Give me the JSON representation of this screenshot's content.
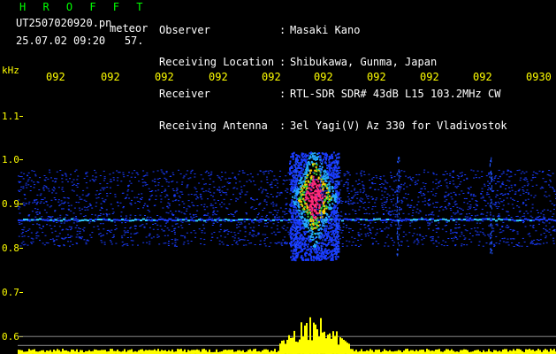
{
  "header": {
    "title": "H R O F F T",
    "file": "UT2507020920.pn",
    "kind": "meteor",
    "stamp": "25.07.02 09:20   57."
  },
  "meta": [
    {
      "label": "Observer",
      "value": "Masaki Kano"
    },
    {
      "label": "Receiving Location",
      "value": "Shibukawa, Gunma, Japan"
    },
    {
      "label": "Receiver",
      "value": "RTL-SDR SDR# 43dB L15 103.2MHz CW"
    },
    {
      "label": "Receiving Antenna",
      "value": "3el Yagi(V) Az 330 for Vladivostok"
    }
  ],
  "meta_colon": ":",
  "axis": {
    "unit": "kHz",
    "time_ticks": [
      "092",
      "092",
      "092",
      "092",
      "092",
      "092",
      "092",
      "092",
      "092",
      "0930"
    ],
    "freq_ticks": [
      "1.1",
      "1.0",
      "0.9",
      "0.8",
      "0.7",
      "0.6"
    ]
  },
  "chart_data": {
    "type": "heatmap",
    "x_range_minutes": [
      "09:20",
      "09:30"
    ],
    "ylim": [
      0.58,
      1.17
    ],
    "carrier_freq_khz": 0.88,
    "noise_band_khz": [
      0.82,
      0.99
    ],
    "meteor_echo": {
      "time_min": 5.5,
      "freq_range_khz": [
        0.79,
        1.03
      ],
      "peak_freq_khz": 0.93
    },
    "colors": {
      "background": "#000000",
      "signal_high": "#ff2a7a",
      "signal_mid": "#33cc44",
      "signal_low": "#1a3cff",
      "power_trace": "#ffff00",
      "axis_text": "#ffff00"
    }
  }
}
